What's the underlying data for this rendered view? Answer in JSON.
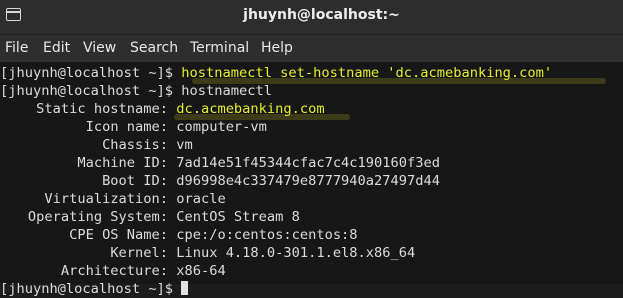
{
  "window": {
    "title": "jhuynh@localhost:~"
  },
  "menu": [
    "File",
    "Edit",
    "View",
    "Search",
    "Terminal",
    "Help"
  ],
  "terminal": {
    "prompt": "[jhuynh@localhost ~]$ ",
    "cmd1": "hostnamectl set-hostname 'dc.acmebanking.com'",
    "cmd2": "hostnamectl",
    "fields": [
      {
        "label": "Static hostname:",
        "value": "dc.acmebanking.com"
      },
      {
        "label": "Icon name:",
        "value": "computer-vm"
      },
      {
        "label": "Chassis:",
        "value": "vm"
      },
      {
        "label": "Machine ID:",
        "value": "7ad14e51f45344cfac7c4c190160f3ed"
      },
      {
        "label": "Boot ID:",
        "value": "d96998e4c337479e8777940a27497d44"
      },
      {
        "label": "Virtualization:",
        "value": "oracle"
      },
      {
        "label": "Operating System:",
        "value": "CentOS Stream 8"
      },
      {
        "label": "CPE OS Name:",
        "value": "cpe:/o:centos:centos:8"
      },
      {
        "label": "Kernel:",
        "value": "Linux 4.18.0-301.1.el8.x86_64"
      },
      {
        "label": "Architecture:",
        "value": "x86-64"
      }
    ],
    "last_prompt": "[jhuynh@localhost ~]$ "
  },
  "colors": {
    "highlight": "#e6ef2b",
    "background": "#171717",
    "text": "#dcdcdc"
  }
}
